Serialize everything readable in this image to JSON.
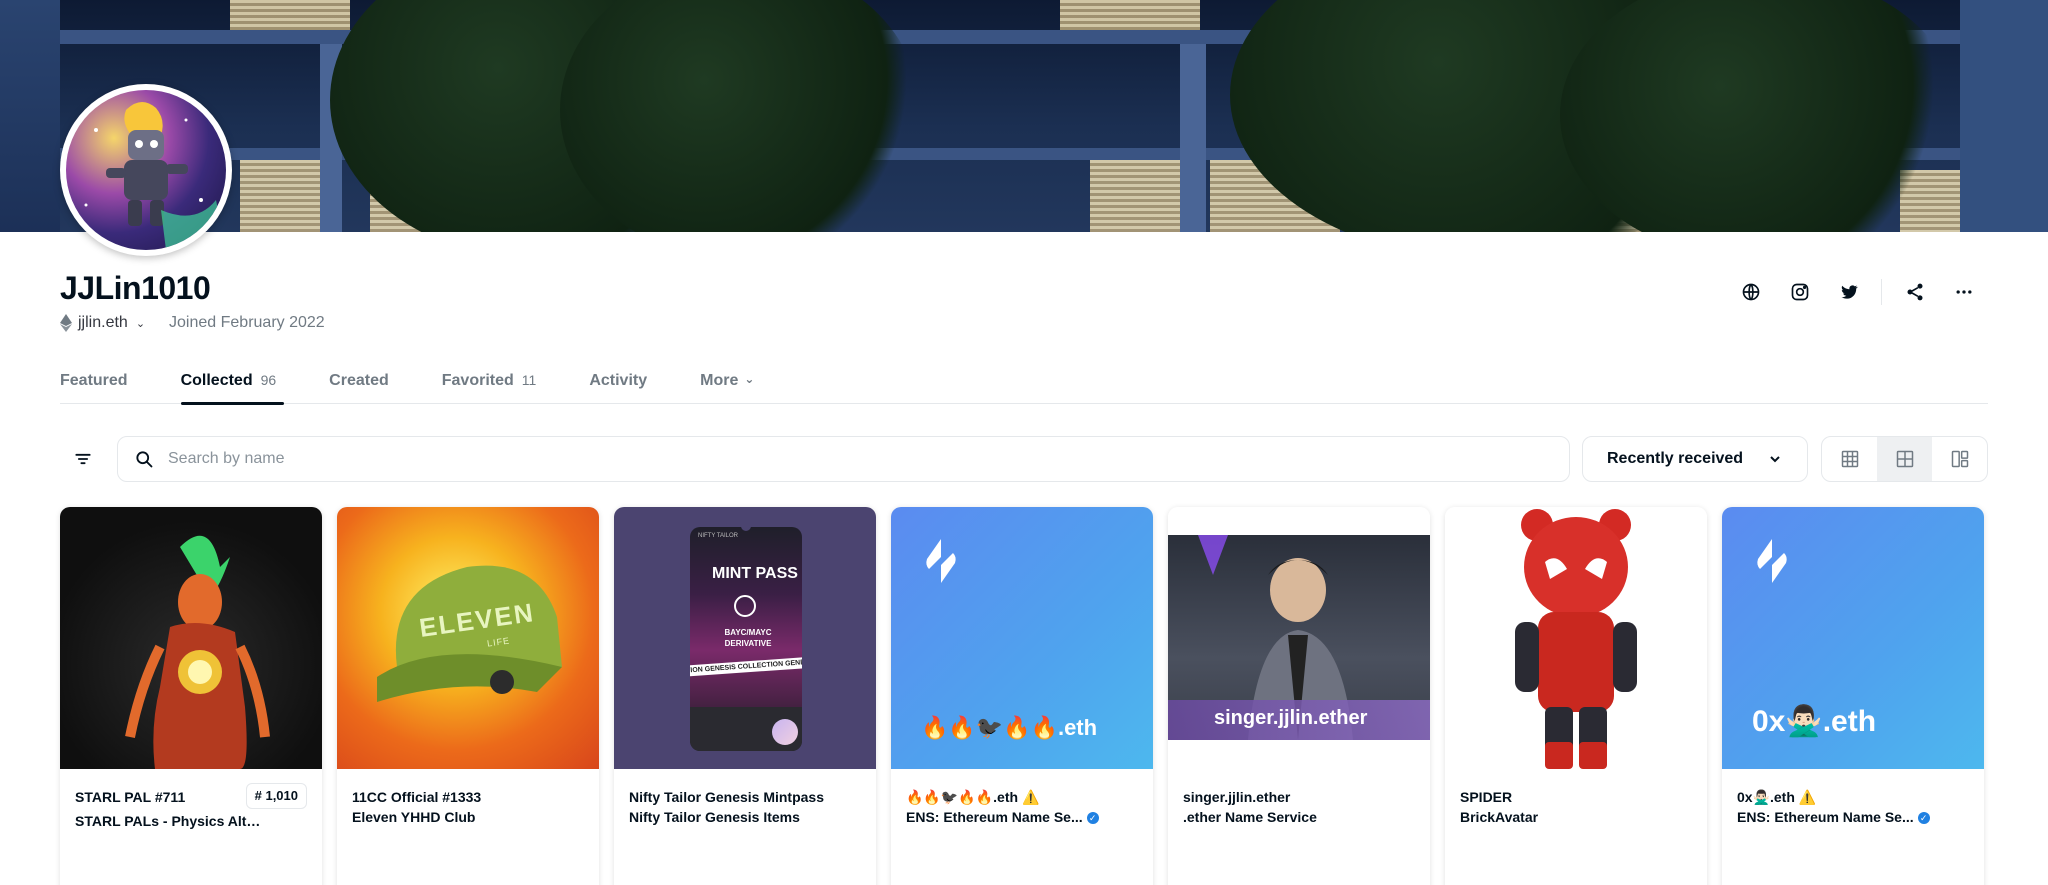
{
  "profile": {
    "username": "JJLin1010",
    "ens": "jjlin.eth",
    "joined": "Joined February 2022"
  },
  "tabs": [
    {
      "label": "Featured",
      "count": ""
    },
    {
      "label": "Collected",
      "count": "96"
    },
    {
      "label": "Created",
      "count": ""
    },
    {
      "label": "Favorited",
      "count": "11"
    },
    {
      "label": "Activity",
      "count": ""
    },
    {
      "label": "More",
      "count": ""
    }
  ],
  "search": {
    "placeholder": "Search by name"
  },
  "sort": {
    "label": "Recently received"
  },
  "colors": {
    "accent": "#2081e2",
    "text": "#04111d",
    "muted": "#707a83",
    "ens_bg": "#5b8bf0"
  },
  "cards": [
    {
      "name": "STARL PAL #711",
      "collection": "STARL PALs - Physics Alteri...",
      "rank": "# 1,010"
    },
    {
      "name": "11CC Official #1333",
      "collection": "Eleven YHHD Club",
      "media_text": "ELEVEN",
      "media_subtext": "LIFE"
    },
    {
      "name": "Nifty Tailor Genesis Mintpass",
      "collection": "Nifty Tailor Genesis Items",
      "media_title": "MINT PASS",
      "media_sub": "BAYC/MAYC DERIVATIVE",
      "media_strip": "TION GENESIS COLLECTION GENESIS",
      "media_brand": "NIFTY TAILOR"
    },
    {
      "name": "🔥🔥🐦‍⬛🔥🔥.eth ⚠️",
      "collection": "ENS: Ethereum Name Se...",
      "media_text": "🔥🔥🐦‍⬛🔥🔥.eth"
    },
    {
      "name": "singer.jjlin.ether",
      "collection": ".ether Name Service",
      "media_text": "singer.jjlin.ether"
    },
    {
      "name": "SPIDER",
      "collection": "BrickAvatar"
    },
    {
      "name": "0x🙅🏻‍♂️.eth ⚠️",
      "collection": "ENS: Ethereum Name Se...",
      "media_text": "0x🙅🏻‍♂️.eth"
    }
  ]
}
